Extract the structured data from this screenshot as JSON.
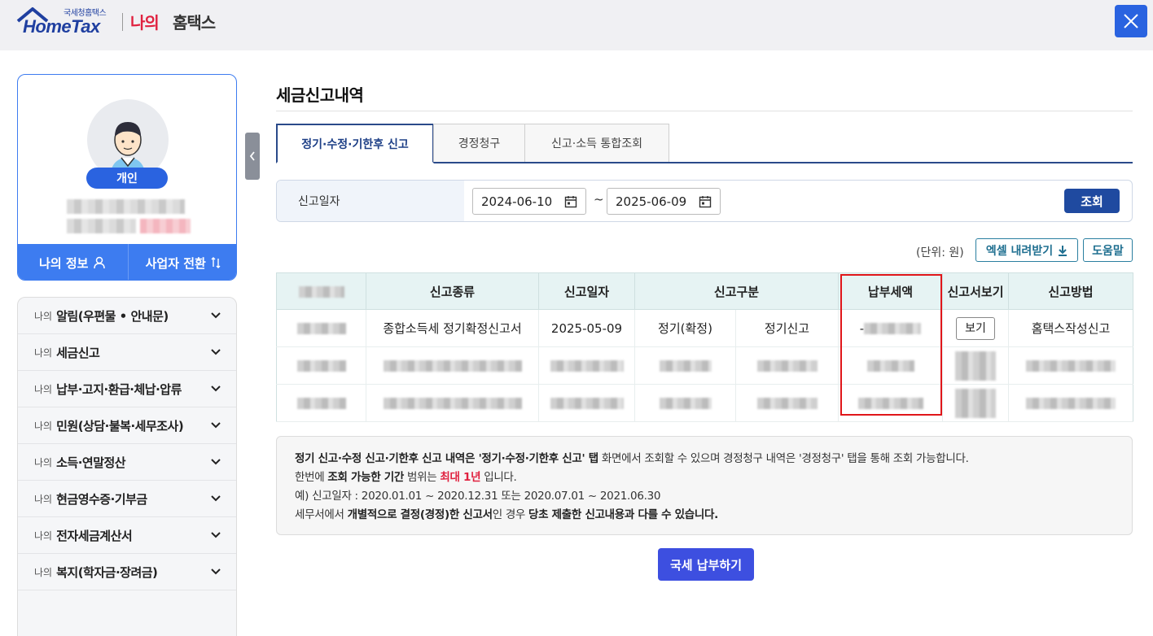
{
  "header": {
    "logo_small": "국세청홈택스",
    "logo_main": "HomeTax",
    "brand_my": "나의",
    "brand_hometax": "홈택스"
  },
  "profile": {
    "badge": "개인",
    "my_info": "나의 정보",
    "switch_business": "사업자 전환"
  },
  "menu": [
    {
      "prefix": "나의",
      "label": "알림(우편물 • 안내문)"
    },
    {
      "prefix": "나의",
      "label": "세금신고"
    },
    {
      "prefix": "나의",
      "label": "납부·고지·환급·체납·압류"
    },
    {
      "prefix": "나의",
      "label": "민원(상담·불복·세무조사)"
    },
    {
      "prefix": "나의",
      "label": "소득·연말정산"
    },
    {
      "prefix": "나의",
      "label": "현금영수증·기부금"
    },
    {
      "prefix": "나의",
      "label": "전자세금계산서"
    },
    {
      "prefix": "나의",
      "label": "복지(학자금·장려금)"
    }
  ],
  "page": {
    "title": "세금신고내역"
  },
  "tabs": [
    {
      "label": "정기·수정·기한후 신고",
      "active": true
    },
    {
      "label": "경정청구",
      "active": false
    },
    {
      "label": "신고·소득 통합조회",
      "active": false
    }
  ],
  "filter": {
    "label": "신고일자",
    "start_date": "2024-06-10",
    "separator": "~",
    "end_date": "2025-06-09",
    "search_label": "조회"
  },
  "toolbar": {
    "unit": "(단위: 원)",
    "excel_label": "엑셀 내려받기",
    "help_label": "도움말"
  },
  "table": {
    "headers": [
      "신고종류",
      "신고일자",
      "신고구분",
      "납부세액",
      "신고서보기",
      "신고방법"
    ],
    "row1": {
      "type": "종합소득세 정기확정신고서",
      "date": "2025-05-09",
      "category_a": "정기(확정)",
      "category_b": "정기신고",
      "tax_prefix": "-",
      "view_label": "보기",
      "method": "홈택스작성신고"
    }
  },
  "notice": {
    "l1_b1": "정기 신고·수정 신고·기한후 신고 내역은 '정기·수정·기한후 신고' 탭",
    "l1_t1": " 화면에서 조회할 수 있으며 경정청구 내역은 '경정청구' 탭을 통해 조회 가능합니다.",
    "l2_t1": "한번에 ",
    "l2_b1": "조회 가능한 기간",
    "l2_t2": " 범위는 ",
    "l2_red": "최대 1년",
    "l2_t3": " 입니다.",
    "l3": "예) 신고일자 : 2020.01.01 ~ 2020.12.31 또는 2020.07.01 ~ 2021.06.30",
    "l4_t1": "세무서에서 ",
    "l4_b1": "개별적으로 결정(경정)한 신고서",
    "l4_t2": "인 경우 ",
    "l4_b2": "당초 제출한 신고내용과 다를 수 있습니다."
  },
  "pay_button": "국세 납부하기",
  "colors": {
    "primary": "#2a63e0",
    "navy": "#1f4aa0",
    "highlight": "#e0161a",
    "accent_red": "#e0213f"
  }
}
